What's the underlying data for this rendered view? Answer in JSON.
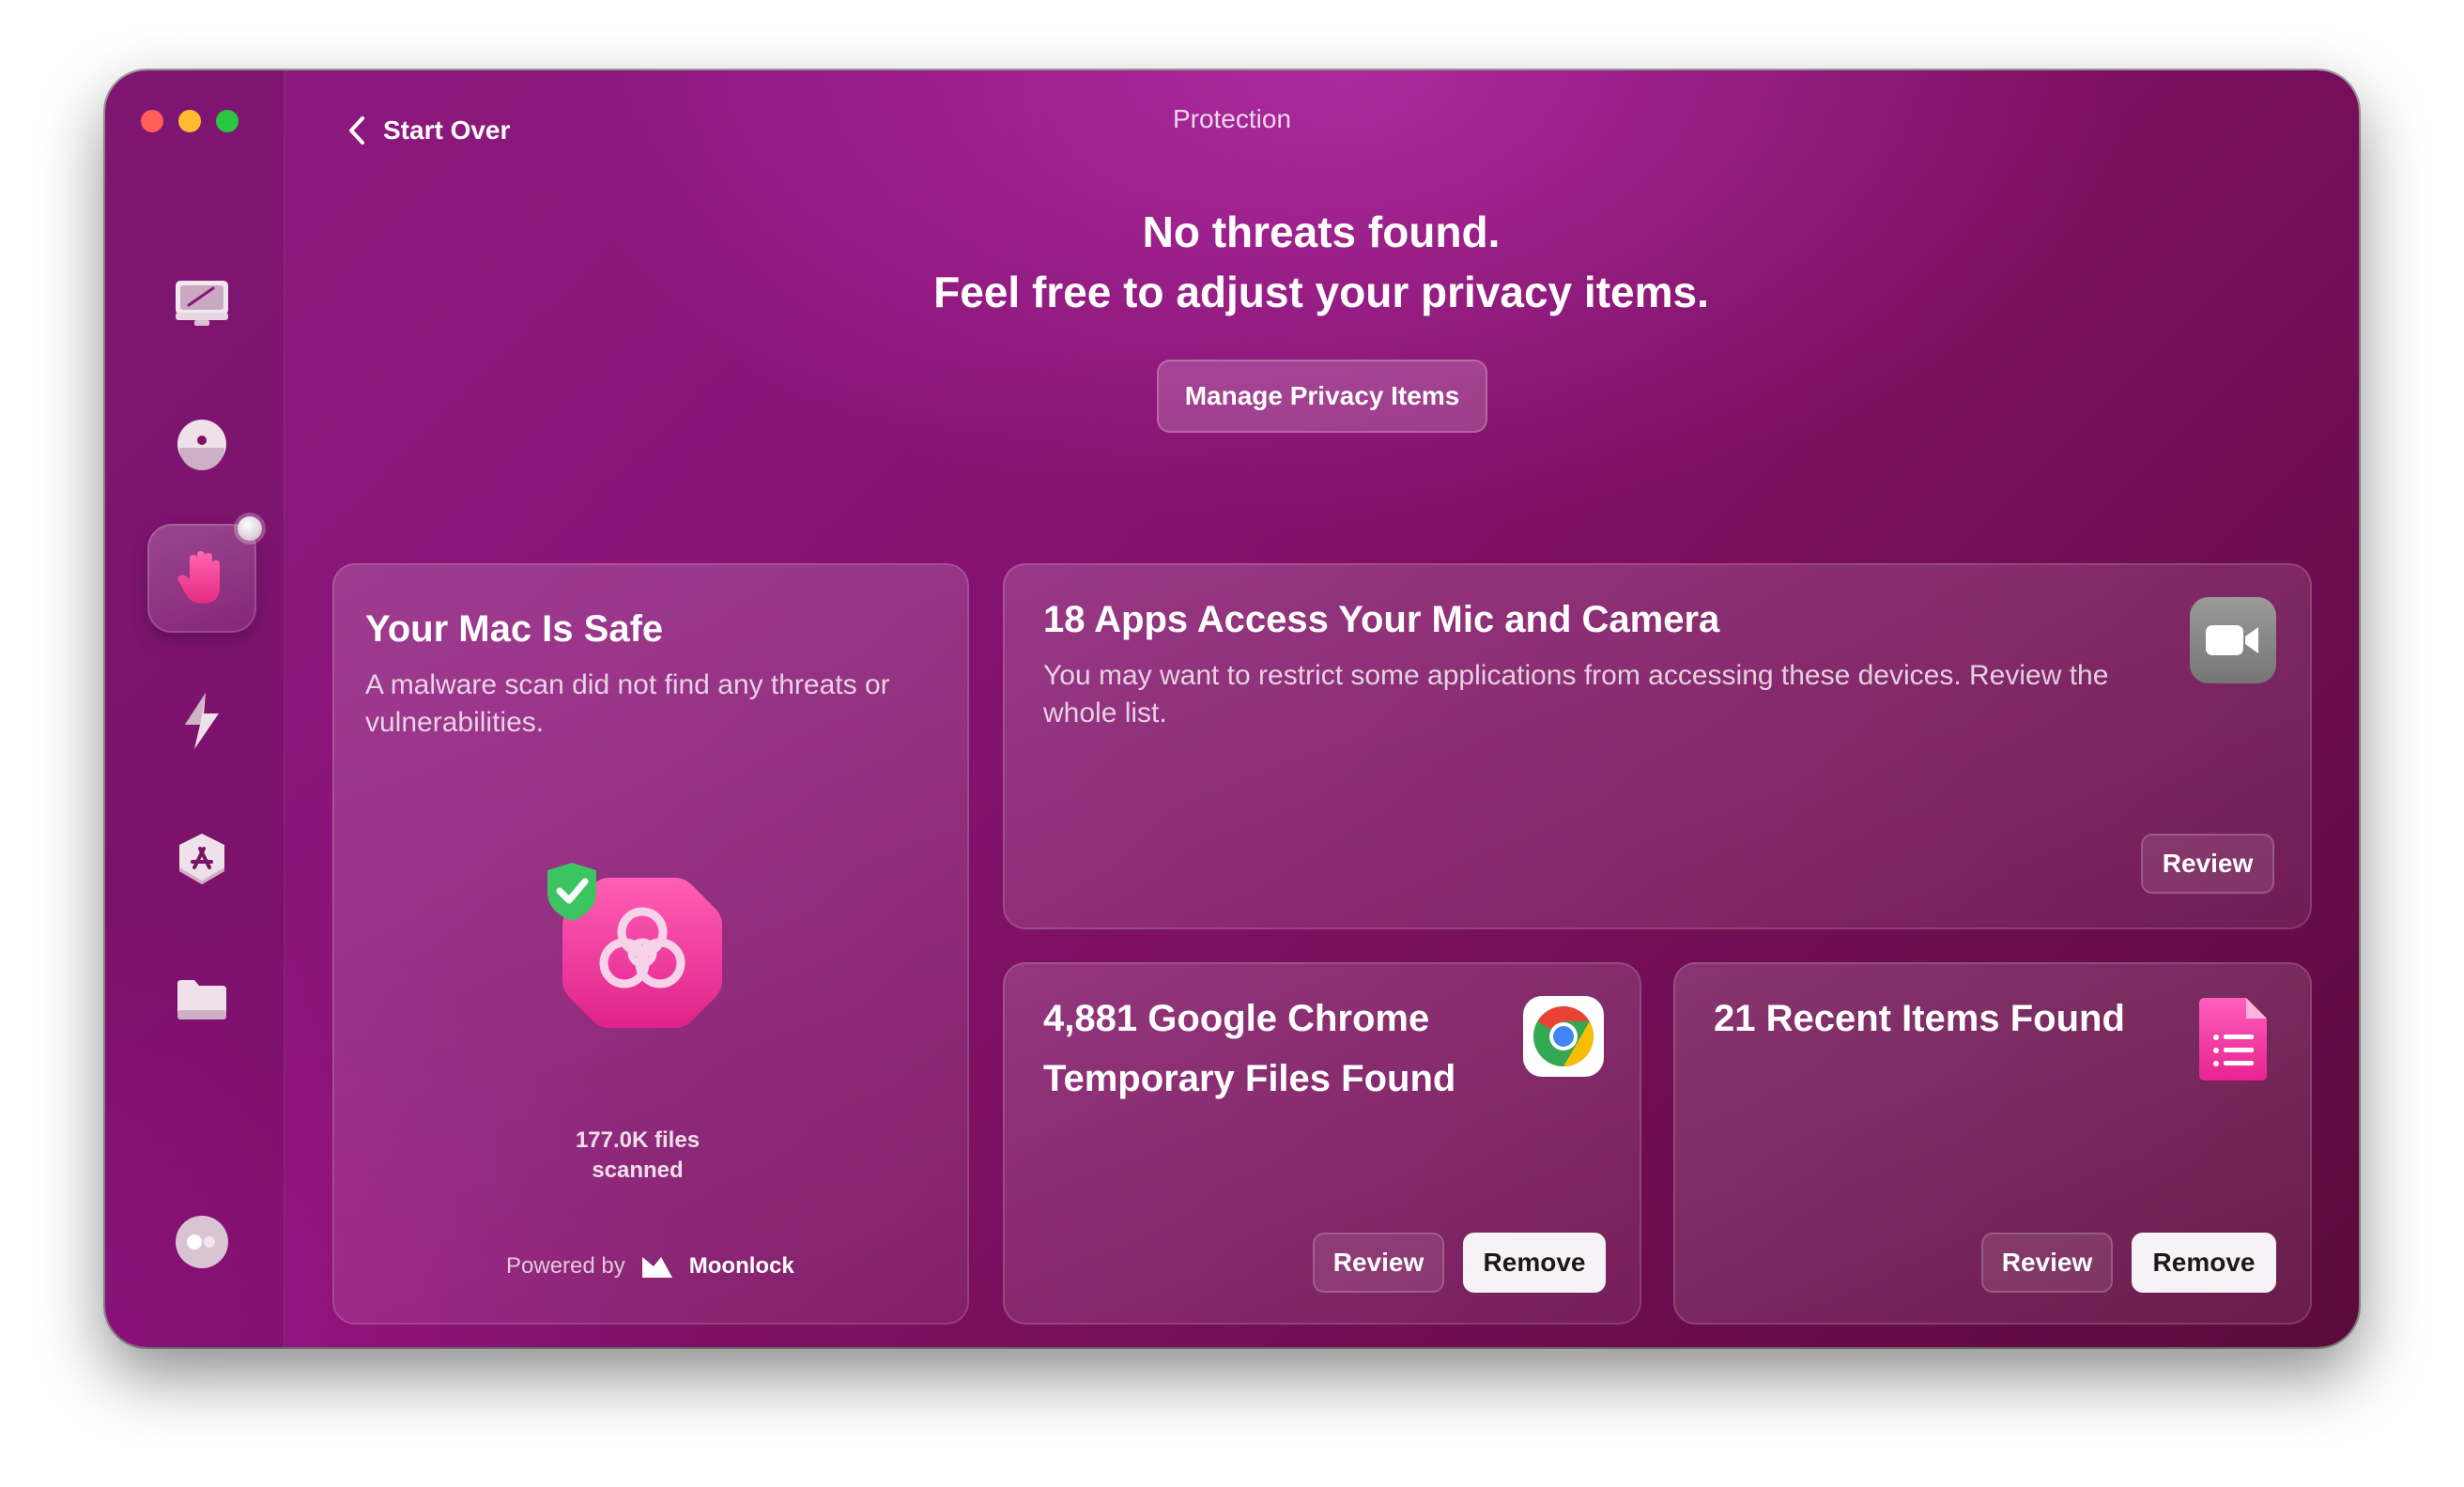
{
  "window": {
    "title": "Protection"
  },
  "nav": {
    "back_label": "Start Over"
  },
  "sidebar": {
    "items": [
      {
        "id": "cleanup",
        "icon": "monitor-broom-icon"
      },
      {
        "id": "protection-scan",
        "icon": "face-icon"
      },
      {
        "id": "protection",
        "icon": "hand-icon",
        "active": true
      },
      {
        "id": "performance",
        "icon": "lightning-icon"
      },
      {
        "id": "applications",
        "icon": "app-store-icon"
      },
      {
        "id": "files",
        "icon": "folder-icon"
      },
      {
        "id": "assistant",
        "icon": "assistant-icon"
      }
    ]
  },
  "hero": {
    "line1": "No threats found.",
    "line2": "Feel free to adjust your privacy items.",
    "button_label": "Manage Privacy Items"
  },
  "safe_card": {
    "title": "Your Mac Is Safe",
    "description": "A malware scan did not find any threats or vulnerabilities.",
    "scan_count_line1": "177.0K files",
    "scan_count_line2": "scanned",
    "powered_by": "Powered by",
    "provider": "Moonlock"
  },
  "mic_card": {
    "title": "18 Apps Access Your Mic and Camera",
    "description": "You may want to restrict some applications from accessing these devices. Review the whole list.",
    "review_label": "Review"
  },
  "chrome_card": {
    "title_line1": "4,881 Google Chrome",
    "title_line2": "Temporary Files Found",
    "review_label": "Review",
    "remove_label": "Remove"
  },
  "recent_card": {
    "title": "21 Recent Items Found",
    "review_label": "Review",
    "remove_label": "Remove"
  },
  "colors": {
    "window_bg": "#8a1478",
    "accent_pink": "#e93c9c",
    "shield_green": "#3cc463",
    "button_solid": "#f6f2f5"
  }
}
